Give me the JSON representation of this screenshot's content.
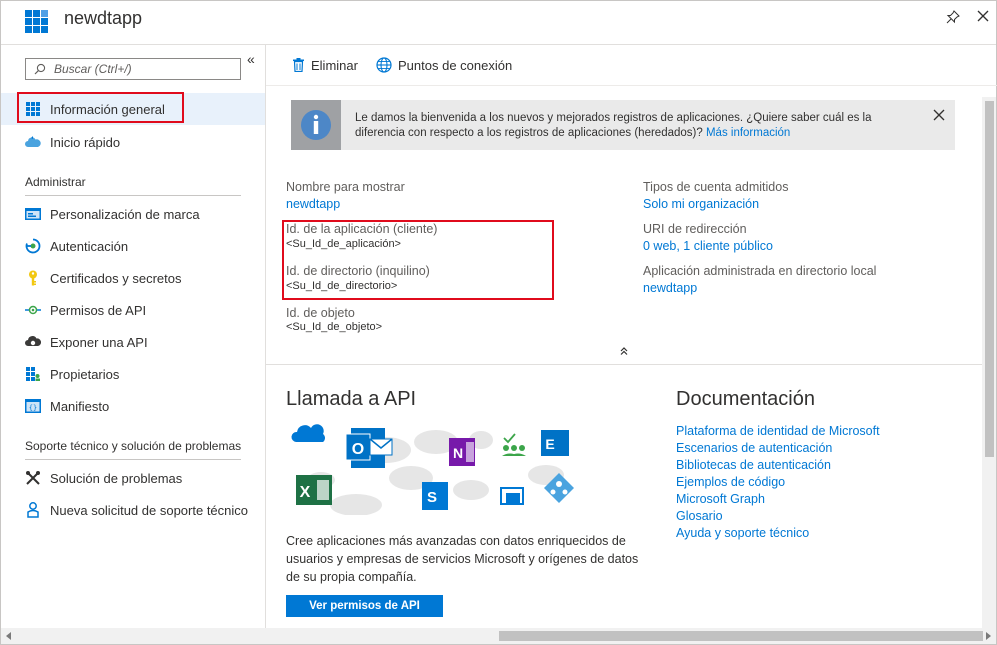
{
  "header": {
    "title": "newdtapp"
  },
  "sidebar": {
    "search_placeholder": "Buscar (Ctrl+/)",
    "top_items": [
      {
        "label": "Información general",
        "icon": "overview-grid-icon"
      },
      {
        "label": "Inicio rápido",
        "icon": "cloud-quickstart-icon"
      }
    ],
    "section_manage": "Administrar",
    "manage_items": [
      {
        "label": "Personalización de marca",
        "icon": "branding-icon"
      },
      {
        "label": "Autenticación",
        "icon": "authentication-icon"
      },
      {
        "label": "Certificados y secretos",
        "icon": "key-icon"
      },
      {
        "label": "Permisos de API",
        "icon": "api-permissions-icon"
      },
      {
        "label": "Exponer una API",
        "icon": "cloud-expose-icon"
      },
      {
        "label": "Propietarios",
        "icon": "owners-grid-icon"
      },
      {
        "label": "Manifiesto",
        "icon": "manifest-icon"
      }
    ],
    "section_support": "Soporte técnico y solución de problemas",
    "support_items": [
      {
        "label": "Solución de problemas",
        "icon": "tools-icon"
      },
      {
        "label": "Nueva solicitud de soporte técnico",
        "icon": "support-person-icon"
      }
    ]
  },
  "toolbar": {
    "delete_label": "Eliminar",
    "endpoints_label": "Puntos de conexión"
  },
  "banner": {
    "text": "Le damos la bienvenida a los nuevos y mejorados registros de aplicaciones. ¿Quiere saber cuál es la diferencia con respecto a los registros de aplicaciones (heredados)?",
    "link": "Más información"
  },
  "essentials": {
    "display_name_label": "Nombre para mostrar",
    "display_name_value": "newdtapp",
    "app_id_label": "Id. de la aplicación (cliente)",
    "app_id_value": "<Su_Id_de_aplicación>",
    "directory_id_label": "Id. de directorio (inquilino)",
    "directory_id_value": "<Su_Id_de_directorio>",
    "object_id_label": "Id. de objeto",
    "object_id_value": "<Su_Id_de_objeto>",
    "account_types_label": "Tipos de cuenta admitidos",
    "account_types_value": "Solo mi organización",
    "redirect_uri_label": "URI de redirección",
    "redirect_uri_value": "0 web, 1 cliente público",
    "managed_app_label": "Aplicación administrada en directorio local",
    "managed_app_value": "newdtapp"
  },
  "api_section": {
    "title": "Llamada a API",
    "description": "Cree aplicaciones más avanzadas con datos enriquecidos de usuarios y empresas de servicios Microsoft y orígenes de datos de su propia compañía.",
    "button": "Ver permisos de API"
  },
  "docs_section": {
    "title": "Documentación",
    "links": [
      "Plataforma de identidad de Microsoft",
      "Escenarios de autenticación",
      "Bibliotecas de autenticación",
      "Ejemplos de código",
      "Microsoft Graph",
      "Glosario",
      "Ayuda y soporte técnico"
    ]
  },
  "colors": {
    "accent": "#0078d4",
    "highlight": "#e00b1c",
    "selected_bg": "#e8f1fb"
  }
}
